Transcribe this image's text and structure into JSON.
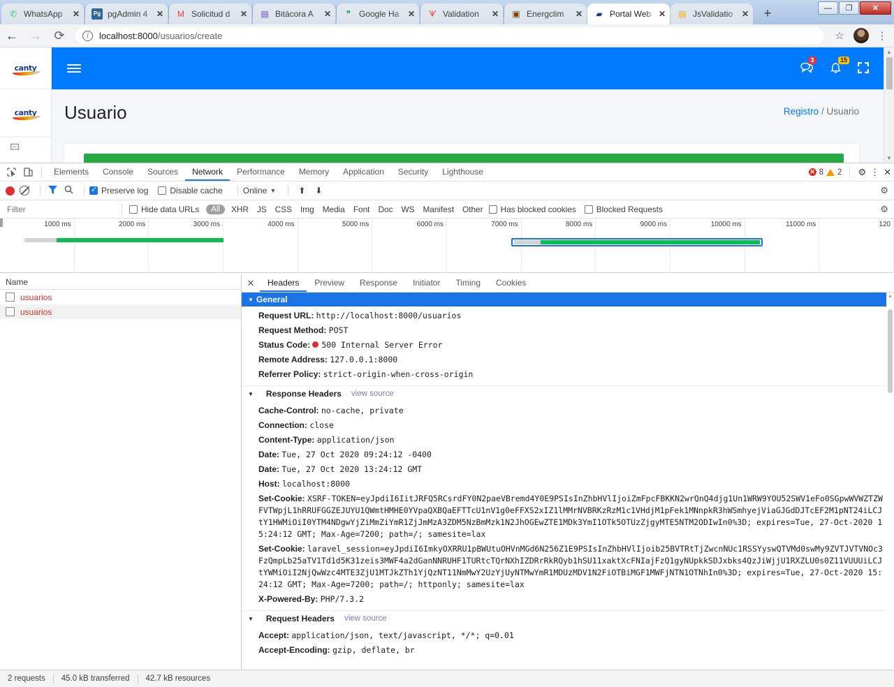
{
  "browser": {
    "tabs": [
      {
        "title": "WhatsApp",
        "favicon": "whatsapp-icon",
        "glyph": "✆",
        "color": "#25D366",
        "active": false
      },
      {
        "title": "pgAdmin 4",
        "favicon": "pgadmin-icon",
        "glyph": "Pg",
        "color": "#336791",
        "active": false
      },
      {
        "title": "Solicitud d",
        "favicon": "gmail-icon",
        "glyph": "M",
        "color": "#EA4335",
        "active": false
      },
      {
        "title": "Bitácora A",
        "favicon": "google-sheets-icon",
        "glyph": "▤",
        "color": "#673AB7",
        "active": false
      },
      {
        "title": "Google Ha",
        "favicon": "google-hangouts-icon",
        "glyph": "❞",
        "color": "#0F9D58",
        "active": false
      },
      {
        "title": "Validation",
        "favicon": "laravel-icon",
        "glyph": "ᗐ",
        "color": "#FF2D20",
        "active": false
      },
      {
        "title": "Energclim",
        "favicon": "energclim-icon",
        "glyph": "▣",
        "color": "#7B3F00",
        "active": false
      },
      {
        "title": "Portal Web",
        "favicon": "cantv-icon",
        "glyph": "▰",
        "color": "#1a3d8f",
        "active": true
      },
      {
        "title": "JsValidatio",
        "favicon": "js-doc-icon",
        "glyph": "▤",
        "color": "#F0AD00",
        "active": false
      }
    ],
    "new_tab_label": "+",
    "close_glyph": "✕",
    "window_controls": {
      "minimize": "—",
      "maximize": "❐",
      "close": "✕"
    },
    "nav": {
      "back": "←",
      "forward": "→",
      "reload": "⟳"
    },
    "url": {
      "info_glyph": "i",
      "host": "localhost:8000",
      "path": "/usuarios/create"
    },
    "star_glyph": "☆",
    "menu_glyph": "⋮"
  },
  "webpage": {
    "brand": "canty",
    "topbar": {
      "hamburger": "menu-icon",
      "chat_badge": "3",
      "bell_badge": "15",
      "expand_icon": "expand-icon"
    },
    "title": "Usuario",
    "breadcrumb": {
      "link": "Registro",
      "separator": "/",
      "current": "Usuario"
    }
  },
  "devtools": {
    "panels": [
      "Elements",
      "Console",
      "Sources",
      "Network",
      "Performance",
      "Memory",
      "Application",
      "Security",
      "Lighthouse"
    ],
    "active_panel": "Network",
    "error_count": "8",
    "warning_count": "2",
    "settings_glyph": "⚙",
    "more_glyph": "⋮",
    "close_glyph": "✕",
    "inspect_glyph": "⬉",
    "device_glyph": "❐",
    "toolbar": {
      "record_label": "record-button",
      "clear_label": "clear-button",
      "filter_label": "filter-icon",
      "search_label": "search-icon",
      "preserve_log": "Preserve log",
      "preserve_log_checked": true,
      "disable_cache": "Disable cache",
      "disable_cache_checked": false,
      "throttle": "Online",
      "caret": "▼",
      "import_glyph": "⬆",
      "export_glyph": "⬇"
    },
    "filterbar": {
      "placeholder": "Filter",
      "hide_data_urls": "Hide data URLs",
      "types": [
        "All",
        "XHR",
        "JS",
        "CSS",
        "Img",
        "Media",
        "Font",
        "Doc",
        "WS",
        "Manifest",
        "Other"
      ],
      "active_type": "All",
      "has_blocked_cookies": "Has blocked cookies",
      "blocked_requests": "Blocked Requests"
    },
    "timeline": {
      "ticks": [
        "1000 ms",
        "2000 ms",
        "3000 ms",
        "4000 ms",
        "5000 ms",
        "6000 ms",
        "7000 ms",
        "8000 ms",
        "9000 ms",
        "10000 ms",
        "11000 ms",
        "120"
      ],
      "bars": [
        {
          "left_pct": 2.7,
          "wait_pct": 3.6,
          "total_pct": 22.3,
          "selected": false
        },
        {
          "left_pct": 57.5,
          "wait_pct": 3.0,
          "total_pct": 27.5,
          "selected": true
        }
      ]
    },
    "requests": {
      "column_header": "Name",
      "rows": [
        {
          "name": "usuarios",
          "failed": true
        },
        {
          "name": "usuarios",
          "failed": true
        }
      ]
    },
    "detail_tabs": [
      "Headers",
      "Preview",
      "Response",
      "Initiator",
      "Timing",
      "Cookies"
    ],
    "active_detail_tab": "Headers",
    "sections": {
      "general": {
        "title": "General",
        "rows": [
          {
            "name": "Request URL:",
            "value": "http://localhost:8000/usuarios"
          },
          {
            "name": "Request Method:",
            "value": "POST"
          },
          {
            "name": "Status Code:",
            "value": "500 Internal Server Error",
            "status_dot": true
          },
          {
            "name": "Remote Address:",
            "value": "127.0.0.1:8000"
          },
          {
            "name": "Referrer Policy:",
            "value": "strict-origin-when-cross-origin"
          }
        ]
      },
      "response_headers": {
        "title": "Response Headers",
        "view_source": "view source",
        "rows": [
          {
            "name": "Cache-Control:",
            "value": "no-cache, private"
          },
          {
            "name": "Connection:",
            "value": "close"
          },
          {
            "name": "Content-Type:",
            "value": "application/json"
          },
          {
            "name": "Date:",
            "value": "Tue, 27 Oct 2020 09:24:12 -0400"
          },
          {
            "name": "Date:",
            "value": "Tue, 27 Oct 2020 13:24:12 GMT"
          },
          {
            "name": "Host:",
            "value": "localhost:8000"
          },
          {
            "name": "Set-Cookie:",
            "value": "XSRF-TOKEN=eyJpdiI6IitJRFQ5RCsrdFY0N2paeVBremd4Y0E9PSIsInZhbHVlIjoiZmFpcFBKKN2wrQnQ4djg1Un1WRW9YOU52SWV1eFo0SGpwWVWZTZWFVTWpjL1hRRUFGGZEJUYU1QWmtHMHE0YVpaQXBQaEFTTcU1nV1g0eFFXS2xIZ1lMMrNVBRKzRzM1c1VHdjM1pFek1MNnpkR3hWSmhyejViaGJGdDJTcEF2M1pNT24iLCJtY1HWMiOiI0YTM4NDgwYjZiMmZiYmR1ZjJmMzA3ZDM5NzBmMzk1N2JhOGEwZTE1MDk3YmI1OTk5OTUzZjgyMTE5NTM2ODIwIn0%3D; expires=Tue, 27-Oct-2020 15:24:12 GMT; Max-Age=7200; path=/; samesite=lax"
          },
          {
            "name": "Set-Cookie:",
            "value": "laravel_session=eyJpdiI6ImkyOXRRU1pBWUtuOHVnMGd6N256Z1E9PSIsInZhbHVlIjoib25BVTRtTjZwcnNUc1RSSYyswQTVMd0swMy9ZVTJVTVNOc3FzQmpLb25aTV1Td1d5K31zeis3MWF4a2dGanNNRUHF1TURtcTQrNXhIZDRrRkRQyb1hSU11xaktXcFNIajFzQ1gyNUpkkSDJxbks4QzJiWjjU1RXZLU0s0Z11VUUUiLCJtYWMiOiI2NjQwWzc4MTE3ZjU1MTJkZTh1YjQzNT11NmMwY2UzYjUyNTMwYmR1MDUzMDV1N2FiOTBiMGF1MWFjNTN1OTNhIn0%3D; expires=Tue, 27-Oct-2020 15:24:12 GMT; Max-Age=7200; path=/; httponly; samesite=lax"
          },
          {
            "name": "X-Powered-By:",
            "value": "PHP/7.3.2"
          }
        ]
      },
      "request_headers": {
        "title": "Request Headers",
        "view_source": "view source",
        "rows": [
          {
            "name": "Accept:",
            "value": "application/json, text/javascript, */*; q=0.01"
          },
          {
            "name": "Accept-Encoding:",
            "value": "gzip, deflate, br"
          }
        ]
      }
    },
    "status": {
      "requests": "2 requests",
      "transferred": "45.0 kB transferred",
      "resources": "42.7 kB resources"
    }
  }
}
